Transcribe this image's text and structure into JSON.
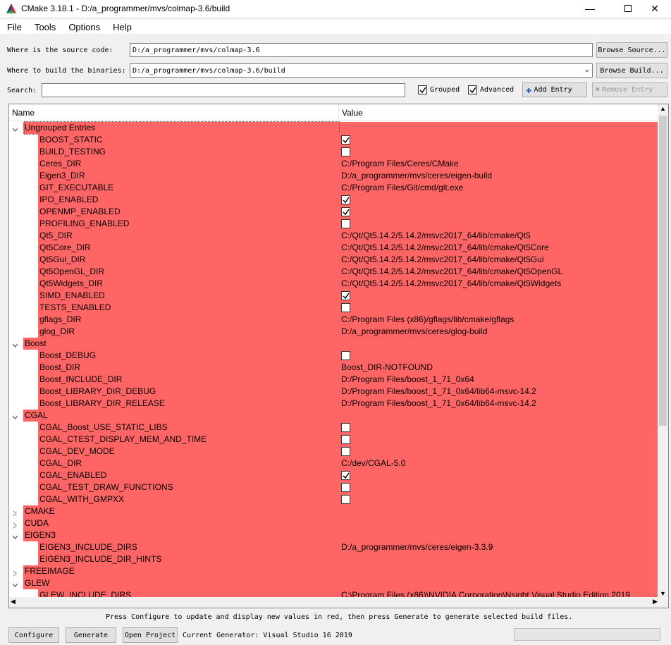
{
  "window": {
    "title": "CMake 3.18.1 - D:/a_programmer/mvs/colmap-3.6/build"
  },
  "menu": [
    "File",
    "Tools",
    "Options",
    "Help"
  ],
  "source": {
    "label": "Where is the source code:",
    "value": "D:/a_programmer/mvs/colmap-3.6",
    "browse": "Browse Source..."
  },
  "build": {
    "label": "Where to build the binaries:",
    "value": "D:/a_programmer/mvs/colmap-3.6/build",
    "browse": "Browse Build..."
  },
  "search": {
    "label": "Search:",
    "value": ""
  },
  "grouped": {
    "label": "Grouped",
    "checked": true
  },
  "advanced": {
    "label": "Advanced",
    "checked": true
  },
  "add_entry": "Add Entry",
  "remove_entry": "Remove Entry",
  "table": {
    "col_name": "Name",
    "col_value": "Value",
    "rows": [
      {
        "kind": "group",
        "name": "Ungrouped Entries",
        "expanded": true
      },
      {
        "kind": "entry",
        "name": "BOOST_STATIC",
        "type": "bool",
        "checked": true
      },
      {
        "kind": "entry",
        "name": "BUILD_TESTING",
        "type": "bool",
        "checked": false
      },
      {
        "kind": "entry",
        "name": "Ceres_DIR",
        "type": "text",
        "value": "C:/Program Files/Ceres/CMake"
      },
      {
        "kind": "entry",
        "name": "Eigen3_DIR",
        "type": "text",
        "value": "D:/a_programmer/mvs/ceres/eigen-build"
      },
      {
        "kind": "entry",
        "name": "GIT_EXECUTABLE",
        "type": "text",
        "value": "C:/Program Files/Git/cmd/git.exe"
      },
      {
        "kind": "entry",
        "name": "IPO_ENABLED",
        "type": "bool",
        "checked": true
      },
      {
        "kind": "entry",
        "name": "OPENMP_ENABLED",
        "type": "bool",
        "checked": true
      },
      {
        "kind": "entry",
        "name": "PROFILING_ENABLED",
        "type": "bool",
        "checked": false
      },
      {
        "kind": "entry",
        "name": "Qt5_DIR",
        "type": "text",
        "value": "C:/Qt/Qt5.14.2/5.14.2/msvc2017_64/lib/cmake/Qt5"
      },
      {
        "kind": "entry",
        "name": "Qt5Core_DIR",
        "type": "text",
        "value": "C:/Qt/Qt5.14.2/5.14.2/msvc2017_64/lib/cmake/Qt5Core"
      },
      {
        "kind": "entry",
        "name": "Qt5Gui_DIR",
        "type": "text",
        "value": "C:/Qt/Qt5.14.2/5.14.2/msvc2017_64/lib/cmake/Qt5Gui"
      },
      {
        "kind": "entry",
        "name": "Qt5OpenGL_DIR",
        "type": "text",
        "value": "C:/Qt/Qt5.14.2/5.14.2/msvc2017_64/lib/cmake/Qt5OpenGL"
      },
      {
        "kind": "entry",
        "name": "Qt5Widgets_DIR",
        "type": "text",
        "value": "C:/Qt/Qt5.14.2/5.14.2/msvc2017_64/lib/cmake/Qt5Widgets"
      },
      {
        "kind": "entry",
        "name": "SIMD_ENABLED",
        "type": "bool",
        "checked": true
      },
      {
        "kind": "entry",
        "name": "TESTS_ENABLED",
        "type": "bool",
        "checked": false
      },
      {
        "kind": "entry",
        "name": "gflags_DIR",
        "type": "text",
        "value": "C:/Program Files (x86)/gflags/lib/cmake/gflags"
      },
      {
        "kind": "entry",
        "name": "glog_DIR",
        "type": "text",
        "value": "D:/a_programmer/mvs/ceres/glog-build"
      },
      {
        "kind": "group",
        "name": "Boost",
        "expanded": true
      },
      {
        "kind": "entry",
        "name": "Boost_DEBUG",
        "type": "bool",
        "checked": false
      },
      {
        "kind": "entry",
        "name": "Boost_DIR",
        "type": "text",
        "value": "Boost_DIR-NOTFOUND"
      },
      {
        "kind": "entry",
        "name": "Boost_INCLUDE_DIR",
        "type": "text",
        "value": "D:/Program Files/boost_1_71_0x64"
      },
      {
        "kind": "entry",
        "name": "Boost_LIBRARY_DIR_DEBUG",
        "type": "text",
        "value": "D:/Program Files/boost_1_71_0x64/lib64-msvc-14.2"
      },
      {
        "kind": "entry",
        "name": "Boost_LIBRARY_DIR_RELEASE",
        "type": "text",
        "value": "D:/Program Files/boost_1_71_0x64/lib64-msvc-14.2"
      },
      {
        "kind": "group",
        "name": "CGAL",
        "expanded": true
      },
      {
        "kind": "entry",
        "name": "CGAL_Boost_USE_STATIC_LIBS",
        "type": "bool",
        "checked": false
      },
      {
        "kind": "entry",
        "name": "CGAL_CTEST_DISPLAY_MEM_AND_TIME",
        "type": "bool",
        "checked": false
      },
      {
        "kind": "entry",
        "name": "CGAL_DEV_MODE",
        "type": "bool",
        "checked": false
      },
      {
        "kind": "entry",
        "name": "CGAL_DIR",
        "type": "text",
        "value": "C:/dev/CGAL-5.0"
      },
      {
        "kind": "entry",
        "name": "CGAL_ENABLED",
        "type": "bool",
        "checked": true
      },
      {
        "kind": "entry",
        "name": "CGAL_TEST_DRAW_FUNCTIONS",
        "type": "bool",
        "checked": false
      },
      {
        "kind": "entry",
        "name": "CGAL_WITH_GMPXX",
        "type": "bool",
        "checked": false
      },
      {
        "kind": "group",
        "name": "CMAKE",
        "expanded": false
      },
      {
        "kind": "group",
        "name": "CUDA",
        "expanded": false
      },
      {
        "kind": "group",
        "name": "EIGEN3",
        "expanded": true
      },
      {
        "kind": "entry",
        "name": "EIGEN3_INCLUDE_DIRS",
        "type": "text",
        "value": "D:/a_programmer/mvs/ceres/eigen-3.3.9"
      },
      {
        "kind": "entry",
        "name": "EIGEN3_INCLUDE_DIR_HINTS",
        "type": "text",
        "value": ""
      },
      {
        "kind": "group",
        "name": "FREEIMAGE",
        "expanded": false
      },
      {
        "kind": "group",
        "name": "GLEW",
        "expanded": true
      },
      {
        "kind": "entry",
        "name": "GLEW_INCLUDE_DIRS",
        "type": "text",
        "value": "C:\\Program Files (x86)\\NVIDIA Corporation\\Nsight Visual Studio Edition 2019"
      }
    ]
  },
  "status_message": "Press Configure to update and display new values in red, then press Generate to generate selected build files.",
  "buttons": {
    "configure": "Configure",
    "generate": "Generate",
    "open_project": "Open Project"
  },
  "generator": "Current Generator: Visual Studio 16 2019",
  "colors": {
    "highlight": "#ff6565",
    "window_bg": "#f0f0f0"
  }
}
